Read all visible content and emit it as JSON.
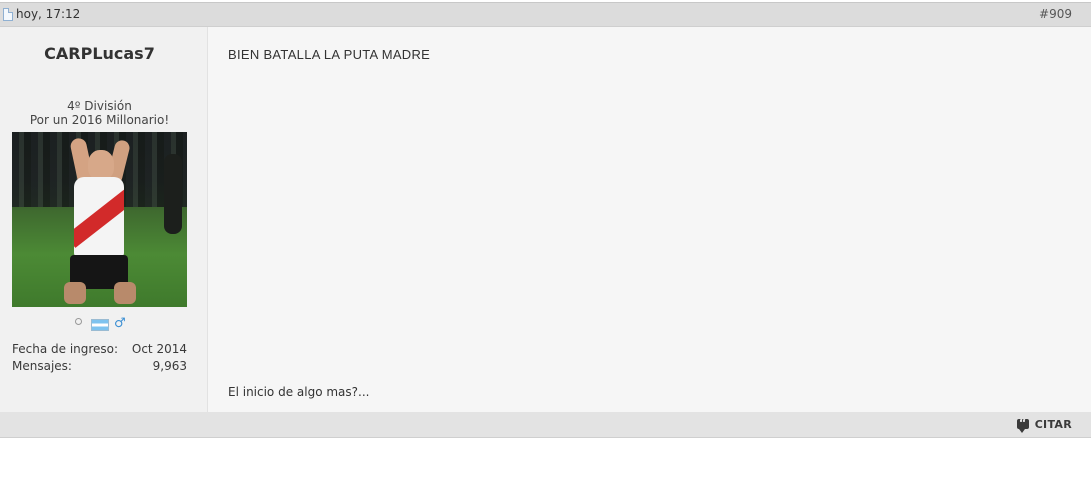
{
  "post": {
    "date": "hoy, 17:12",
    "number": "#909",
    "message": "BIEN BATALLA LA PUTA MADRE",
    "signature": "El inicio de algo mas?...",
    "quote_label": "CITAR"
  },
  "user": {
    "username": "CARPLucas7",
    "rank": "4º División",
    "custom_title": "Por un 2016 Millonario!",
    "avatar_icon": "avatar-river-plate-player",
    "status_icons": [
      "offline-status-icon",
      "argentina-flag-icon",
      "male-gender-icon"
    ],
    "stats": [
      {
        "label": "Fecha de ingreso:",
        "value": "Oct 2014"
      },
      {
        "label": "Mensajes:",
        "value": "9,963"
      }
    ]
  },
  "colors": {
    "header_bg": "#dcdcdc",
    "body_bg": "#f6f6f6",
    "sidebar_bg": "#f1f1f1",
    "footer_bg": "#e3e3e3"
  }
}
